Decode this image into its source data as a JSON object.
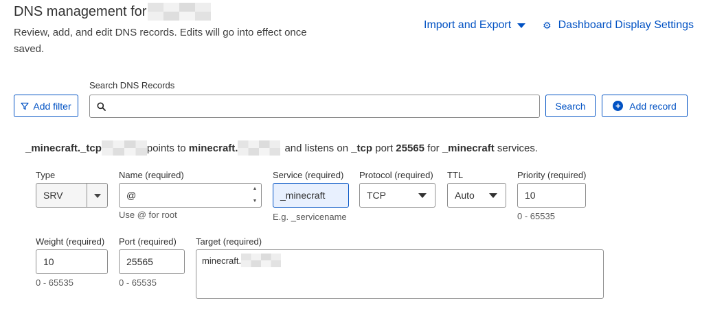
{
  "header": {
    "title": "DNS management for",
    "subtitle": "Review, add, and edit DNS records. Edits will go into effect once saved.",
    "import_export": "Import and Export",
    "dashboard_settings": "Dashboard Display Settings"
  },
  "toolbar": {
    "add_filter": "Add filter",
    "search_label": "Search DNS Records",
    "search_value": "",
    "search_button": "Search",
    "add_record": "Add record"
  },
  "summary": {
    "record_name": "_minecraft._tcp",
    "points_to": "points to",
    "target": "minecraft.",
    "listens_on": "and listens on",
    "protocol": "_tcp",
    "port_word": "port",
    "port": "25565",
    "for_word": "for",
    "service": "_minecraft",
    "services_word": "services."
  },
  "form": {
    "type": {
      "label": "Type",
      "value": "SRV"
    },
    "name": {
      "label": "Name (required)",
      "value": "@",
      "hint": "Use @ for root"
    },
    "service": {
      "label": "Service (required)",
      "value": "_minecraft",
      "hint": "E.g. _servicename"
    },
    "protocol": {
      "label": "Protocol (required)",
      "value": "TCP"
    },
    "ttl": {
      "label": "TTL",
      "value": "Auto"
    },
    "priority": {
      "label": "Priority (required)",
      "value": "10",
      "hint": "0 - 65535"
    },
    "weight": {
      "label": "Weight (required)",
      "value": "10",
      "hint": "0 - 65535"
    },
    "port": {
      "label": "Port (required)",
      "value": "25565",
      "hint": "0 - 65535"
    },
    "target": {
      "label": "Target (required)",
      "value": "minecraft."
    }
  },
  "colors": {
    "accent": "#0051c3",
    "text": "#313131",
    "border": "#8e8e8e"
  }
}
